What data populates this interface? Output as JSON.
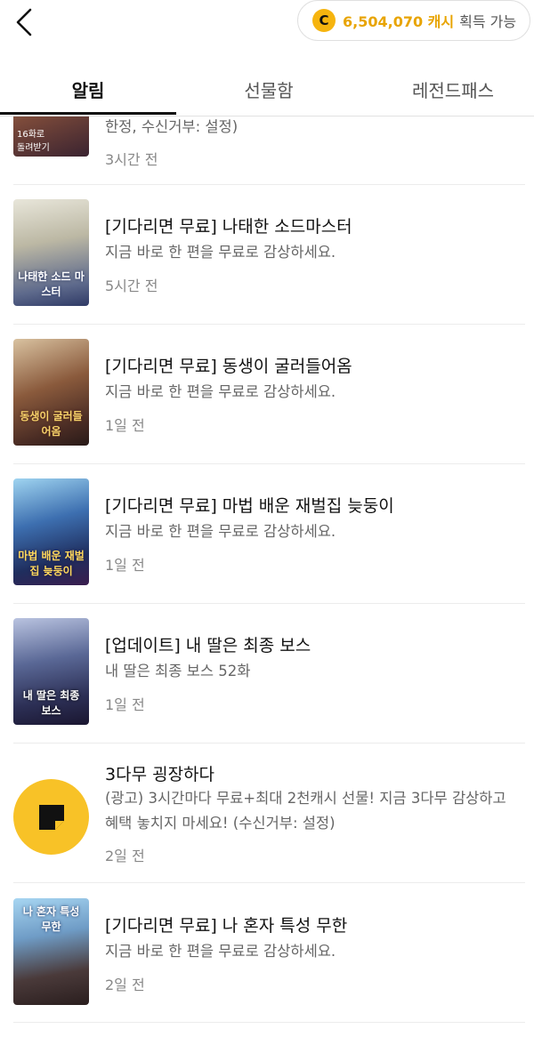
{
  "header": {
    "cash_amount": "6,504,070 캐시",
    "cash_suffix": "획득 가능",
    "coin_letter": "C"
  },
  "tabs": [
    {
      "label": "알림",
      "active": true
    },
    {
      "label": "선물함",
      "active": false
    },
    {
      "label": "레전드패스",
      "active": false
    }
  ],
  "notifications": [
    {
      "title": "",
      "body": "한정, 수신거부: 설정)",
      "time": "3시간 전",
      "thumb_text": "16화로 \n돌려받기"
    },
    {
      "title": "[기다리면 무료] 나태한 소드마스터",
      "body": "지금 바로 한 편을 무료로 감상하세요.",
      "time": "5시간 전",
      "thumb_text": "나태한 소드 마스터"
    },
    {
      "title": "[기다리면 무료] 동생이 굴러들어옴",
      "body": "지금 바로 한 편을 무료로 감상하세요.",
      "time": "1일 전",
      "thumb_text": "동생이 굴러들어옴"
    },
    {
      "title": "[기다리면 무료] 마법 배운 재벌집 늦둥이",
      "body": "지금 바로 한 편을 무료로 감상하세요.",
      "time": "1일 전",
      "thumb_text": "마법 배운 재벌집 늦둥이"
    },
    {
      "title": "[업데이트] 내 딸은 최종 보스",
      "body": "내 딸은 최종 보스 52화",
      "time": "1일 전",
      "thumb_text": "내 딸은 최종 보스"
    },
    {
      "title": "3다무 굉장하다",
      "body": "(광고) 3시간마다 무료+최대 2천캐시 선물! 지금 3다무 감상하고 혜택 놓치지 마세요! (수신거부: 설정)",
      "time": "2일 전",
      "thumb_text": ""
    },
    {
      "title": "[기다리면 무료] 나 혼자 특성 무한",
      "body": "지금 바로 한 편을 무료로 감상하세요.",
      "time": "2일 전",
      "thumb_text": "나 혼자 특성 무한"
    }
  ]
}
